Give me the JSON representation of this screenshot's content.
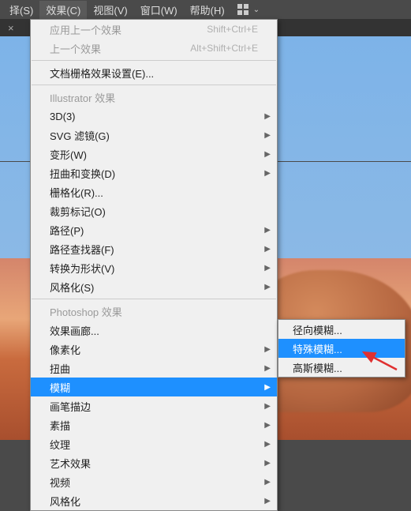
{
  "menubar": {
    "items": [
      "择(S)",
      "效果(C)",
      "视图(V)",
      "窗口(W)",
      "帮助(H)"
    ],
    "active_index": 1
  },
  "main_menu": {
    "sections": [
      [
        {
          "label": "应用上一个效果",
          "shortcut": "Shift+Ctrl+E",
          "disabled": true
        },
        {
          "label": "上一个效果",
          "shortcut": "Alt+Shift+Ctrl+E",
          "disabled": true
        }
      ],
      [
        {
          "label": "文档栅格效果设置(E)..."
        }
      ],
      [
        {
          "label": "Illustrator 效果",
          "disabled": true
        },
        {
          "label": "3D(3)",
          "submenu": true
        },
        {
          "label": "SVG 滤镜(G)",
          "submenu": true
        },
        {
          "label": "变形(W)",
          "submenu": true
        },
        {
          "label": "扭曲和变换(D)",
          "submenu": true
        },
        {
          "label": "栅格化(R)..."
        },
        {
          "label": "裁剪标记(O)"
        },
        {
          "label": "路径(P)",
          "submenu": true
        },
        {
          "label": "路径查找器(F)",
          "submenu": true
        },
        {
          "label": "转换为形状(V)",
          "submenu": true
        },
        {
          "label": "风格化(S)",
          "submenu": true
        }
      ],
      [
        {
          "label": "Photoshop 效果",
          "disabled": true
        },
        {
          "label": "效果画廊..."
        },
        {
          "label": "像素化",
          "submenu": true
        },
        {
          "label": "扭曲",
          "submenu": true
        },
        {
          "label": "模糊",
          "submenu": true,
          "highlight": true
        },
        {
          "label": "画笔描边",
          "submenu": true
        },
        {
          "label": "素描",
          "submenu": true
        },
        {
          "label": "纹理",
          "submenu": true
        },
        {
          "label": "艺术效果",
          "submenu": true
        },
        {
          "label": "视频",
          "submenu": true
        },
        {
          "label": "风格化",
          "submenu": true
        }
      ]
    ]
  },
  "submenu": {
    "items": [
      {
        "label": "径向模糊..."
      },
      {
        "label": "特殊模糊...",
        "highlight": true
      },
      {
        "label": "高斯模糊..."
      }
    ]
  },
  "tabs": {
    "close_glyph": "×"
  },
  "arrow_color": "#e03030"
}
